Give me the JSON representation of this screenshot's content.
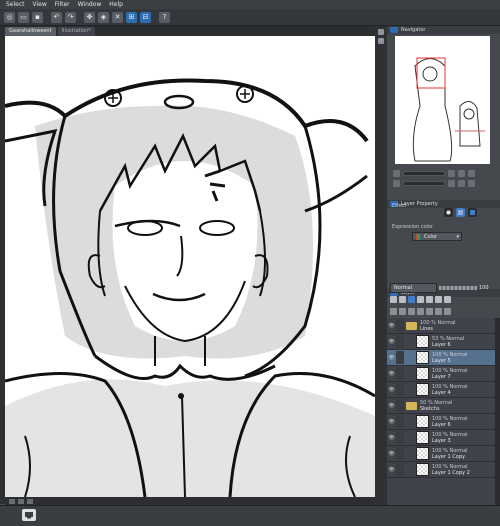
{
  "menu": [
    "Select",
    "View",
    "Filter",
    "Window",
    "Help"
  ],
  "doc_tabs": [
    {
      "label": "Gaarahalloweent",
      "active": true
    },
    {
      "label": "Illustration*",
      "active": false
    }
  ],
  "panels": {
    "navigator": {
      "title": "Navigator"
    },
    "layer_property": {
      "title": "Layer Property",
      "effect_label": "Effect",
      "expression_color_label": "Expression color",
      "expression_color_value": "Color"
    },
    "layer": {
      "title": "Layer",
      "blend_mode": "Normal",
      "opacity": "100"
    }
  },
  "layers": [
    {
      "type": "folder",
      "opacity": "100 % Normal",
      "name": "Lines",
      "indent": 0,
      "selected": false
    },
    {
      "type": "layer",
      "opacity": "53 % Normal",
      "name": "Layer 6",
      "indent": 1,
      "selected": false
    },
    {
      "type": "layer",
      "opacity": "100 % Normal",
      "name": "Layer 5",
      "indent": 1,
      "selected": true
    },
    {
      "type": "layer",
      "opacity": "100 % Normal",
      "name": "Layer 7",
      "indent": 1,
      "selected": false
    },
    {
      "type": "layer",
      "opacity": "100 % Normal",
      "name": "Layer 4",
      "indent": 1,
      "selected": false
    },
    {
      "type": "folder",
      "opacity": "50 % Normal",
      "name": "Sketchs",
      "indent": 0,
      "selected": false
    },
    {
      "type": "layer",
      "opacity": "100 % Normal",
      "name": "Layer 6",
      "indent": 1,
      "selected": false
    },
    {
      "type": "layer",
      "opacity": "100 % Normal",
      "name": "Layer 3",
      "indent": 1,
      "selected": false
    },
    {
      "type": "layer",
      "opacity": "100 % Normal",
      "name": "Layer 1 Copy",
      "indent": 1,
      "selected": false
    },
    {
      "type": "layer",
      "opacity": "100 % Normal",
      "name": "Layer 1 Copy 2",
      "indent": 1,
      "selected": false
    }
  ],
  "icons": {
    "toolbar": [
      "new-file-icon",
      "open-icon",
      "save-icon",
      "undo-icon",
      "redo-icon",
      "transform-icon",
      "fill-icon",
      "clear-icon",
      "snap-icon",
      "ruler-icon",
      "help-icon"
    ],
    "accent": "#2f6db3",
    "selected_row": "#56718e"
  }
}
